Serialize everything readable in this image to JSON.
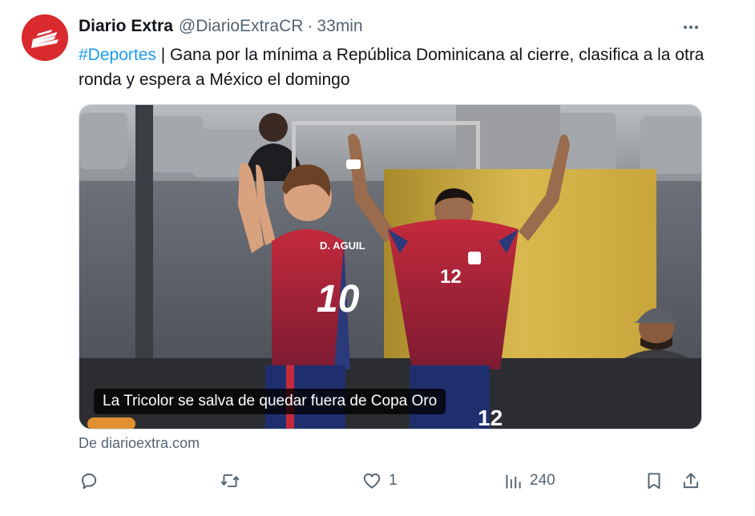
{
  "author": {
    "name": "Diario Extra",
    "handle": "@DiarioExtraCR",
    "separator": "·",
    "time": "33min"
  },
  "post": {
    "hashtag": "#Deportes",
    "separator": " | ",
    "text": "Gana por la mínima a República Dominicana al cierre, clasifica a la otra ronda y espera a México el domingo"
  },
  "media": {
    "caption": "La Tricolor se salva de quedar fuera de Copa Oro"
  },
  "link": {
    "source": "De diarioextra.com"
  },
  "actions": {
    "reply_count": "",
    "repost_count": "",
    "like_count": "1",
    "views_count": "240"
  },
  "icons": {
    "more": "more-horizontal-icon",
    "reply": "speech-bubble-icon",
    "repost": "repost-arrows-icon",
    "like": "heart-icon",
    "views": "bar-chart-icon",
    "bookmark": "bookmark-icon",
    "share": "share-upload-icon"
  },
  "colors": {
    "accent": "#1d9bf0",
    "text": "#0f1419",
    "secondary": "#536471",
    "brand": "#d92a2e"
  }
}
